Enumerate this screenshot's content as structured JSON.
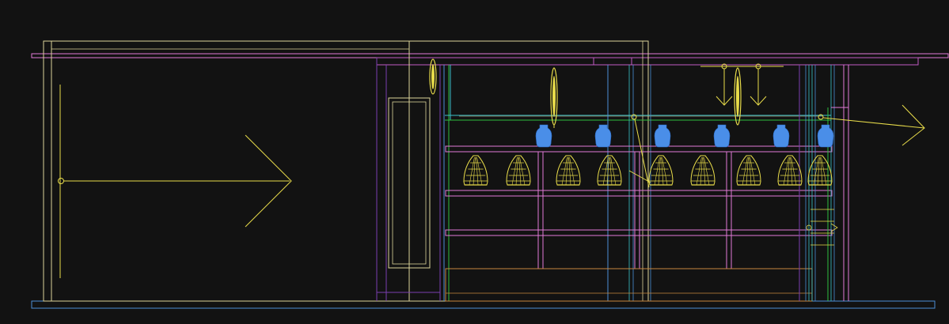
{
  "drawing": {
    "background": "#121212",
    "colors": {
      "yellow": "#e8dc4a",
      "pale_yellow": "#dcd49a",
      "magenta": "#c25bc4",
      "pink": "#e27ad8",
      "purple": "#7a3fb0",
      "blue_line": "#4c8fd6",
      "cyan": "#39c3c9",
      "green": "#2fbf3f",
      "orange": "#c7873f",
      "vase_blue": "#4a8ee8",
      "white": "#dddddd"
    },
    "objects": {
      "pendant_count": 8,
      "vase_count": 6,
      "cabinet_shelves": 4
    }
  }
}
